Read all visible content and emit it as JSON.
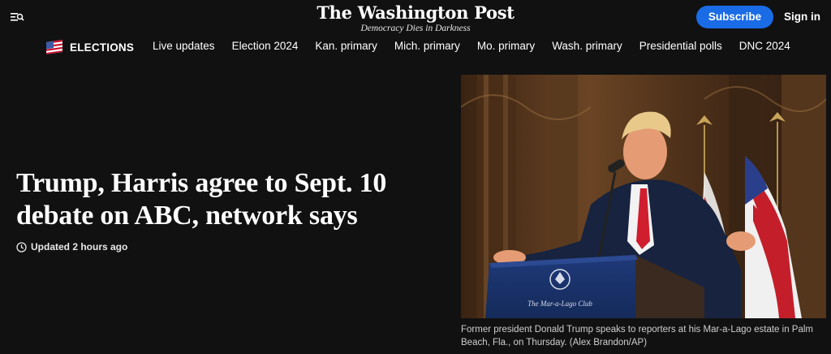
{
  "header": {
    "logo": "The Washington Post",
    "tagline": "Democracy Dies in Darkness",
    "subscribe_label": "Subscribe",
    "signin_label": "Sign in",
    "menu_icon": "menu-search-icon",
    "accent_color": "#1a6be6"
  },
  "nav": {
    "section_label": "ELECTIONS",
    "section_icon": "flag-icon",
    "links": [
      "Live updates",
      "Election 2024",
      "Kan. primary",
      "Mich. primary",
      "Mo. primary",
      "Wash. primary",
      "Presidential polls",
      "DNC 2024"
    ]
  },
  "article": {
    "headline_line1": "Trump, Harris agree to Sept. 10",
    "headline_line2": "debate on ABC, network says",
    "timestamp": "Updated 2 hours ago",
    "timestamp_icon": "clock-icon",
    "podium_text": "The Mar-a-Lago Club",
    "caption": "Former president Donald Trump speaks to reporters at his Mar-a-Lago estate in Palm Beach, Fla., on Thursday. (Alex Brandon/AP)"
  }
}
